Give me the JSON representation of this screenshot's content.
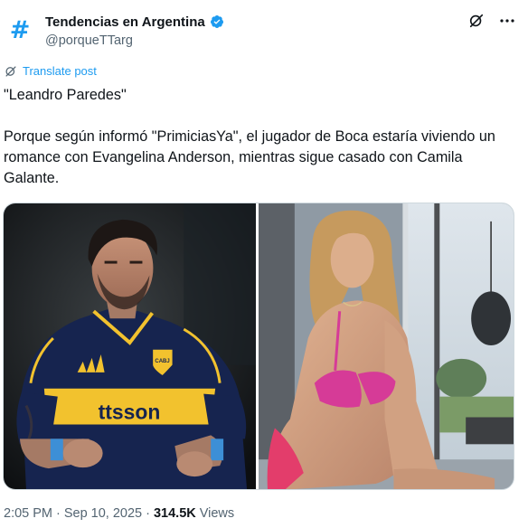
{
  "account": {
    "avatar_glyph": "#",
    "display_name": "Tendencias en Argentina",
    "handle": "@porqueTTarg",
    "verified_color": "#1d9bf0"
  },
  "translate": {
    "label": "Translate post"
  },
  "tweet": {
    "line1": "\"Leandro Paredes\"",
    "line2": "Porque según informó \"PrimiciasYa\", el jugador de Boca estaría viviendo un romance con Evangelina Anderson, mientras sigue casado con Camila Galante."
  },
  "media": {
    "left": {
      "jersey_text": "ttsson",
      "crest_text": "CABJ"
    },
    "right": {}
  },
  "meta": {
    "time": "2:05 PM",
    "separator": "·",
    "date": "Sep 10, 2025",
    "separator2": "·",
    "views_count": "314.5K",
    "views_label": "Views"
  },
  "colors": {
    "accent": "#1d9bf0",
    "muted": "#536471",
    "text": "#0f1419"
  },
  "icons": [
    "hash-avatar-icon",
    "verified-badge-icon",
    "grok-icon",
    "more-icon",
    "translate-icon"
  ]
}
